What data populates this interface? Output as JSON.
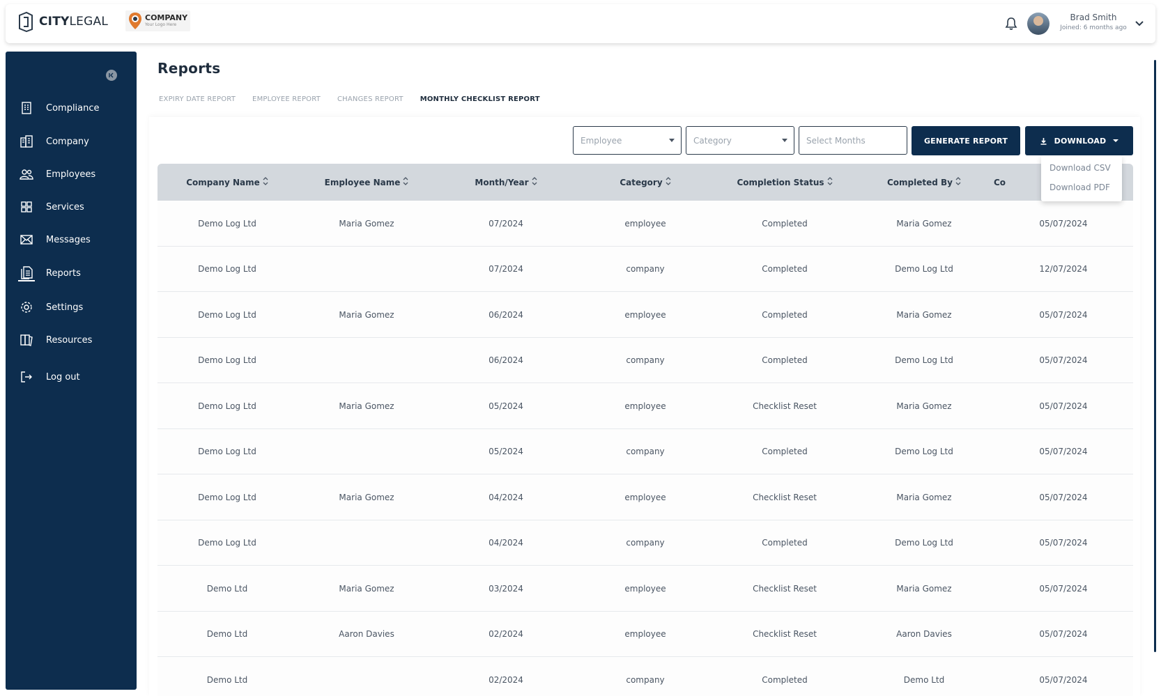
{
  "brand": {
    "name_bold": "CITY",
    "name_light": "LEGAL"
  },
  "company_logo": {
    "name": "COMPANY",
    "tagline": "Your Logo Here"
  },
  "user": {
    "name": "Brad Smith",
    "subtitle": "Joined: 6 months ago"
  },
  "sidebar": {
    "items": [
      {
        "label": "Compliance",
        "icon": "building-icon"
      },
      {
        "label": "Company",
        "icon": "office-icon"
      },
      {
        "label": "Employees",
        "icon": "users-icon"
      },
      {
        "label": "Services",
        "icon": "grid-icon"
      },
      {
        "label": "Messages",
        "icon": "envelope-icon"
      },
      {
        "label": "Reports",
        "icon": "document-icon",
        "active": true
      },
      {
        "label": "Settings",
        "icon": "gear-icon"
      },
      {
        "label": "Resources",
        "icon": "books-icon"
      },
      {
        "label": "Log out",
        "icon": "logout-icon"
      }
    ]
  },
  "page": {
    "title": "Reports"
  },
  "tabs": [
    {
      "label": "EXPIRY DATE REPORT"
    },
    {
      "label": "EMPLOYEE REPORT"
    },
    {
      "label": "CHANGES REPORT"
    },
    {
      "label": "MONTHLY CHECKLIST REPORT",
      "active": true
    }
  ],
  "filters": {
    "employee_placeholder": "Employee",
    "category_placeholder": "Category",
    "months_placeholder": "Select Months",
    "generate_label": "GENERATE REPORT",
    "download_label": "DOWNLOAD",
    "download_options": [
      "Download CSV",
      "Download PDF"
    ]
  },
  "table": {
    "columns": [
      "Company Name",
      "Employee Name",
      "Month/Year",
      "Category",
      "Completion Status",
      "Completed By",
      "Co"
    ],
    "rows": [
      [
        "Demo Log Ltd",
        "Maria Gomez",
        "07/2024",
        "employee",
        "Completed",
        "Maria Gomez",
        "05/07/2024"
      ],
      [
        "Demo Log Ltd",
        "",
        "07/2024",
        "company",
        "Completed",
        "Demo Log Ltd",
        "12/07/2024"
      ],
      [
        "Demo Log Ltd",
        "Maria Gomez",
        "06/2024",
        "employee",
        "Completed",
        "Maria Gomez",
        "05/07/2024"
      ],
      [
        "Demo Log Ltd",
        "",
        "06/2024",
        "company",
        "Completed",
        "Demo Log Ltd",
        "05/07/2024"
      ],
      [
        "Demo Log Ltd",
        "Maria Gomez",
        "05/2024",
        "employee",
        "Checklist Reset",
        "Maria Gomez",
        "05/07/2024"
      ],
      [
        "Demo Log Ltd",
        "",
        "05/2024",
        "company",
        "Completed",
        "Demo Log Ltd",
        "05/07/2024"
      ],
      [
        "Demo Log Ltd",
        "Maria Gomez",
        "04/2024",
        "employee",
        "Checklist Reset",
        "Maria Gomez",
        "05/07/2024"
      ],
      [
        "Demo Log Ltd",
        "",
        "04/2024",
        "company",
        "Completed",
        "Demo Log Ltd",
        "05/07/2024"
      ],
      [
        "Demo Ltd",
        "Maria Gomez",
        "03/2024",
        "employee",
        "Checklist Reset",
        "Maria Gomez",
        "05/07/2024"
      ],
      [
        "Demo Ltd",
        "Aaron Davies",
        "02/2024",
        "employee",
        "Checklist Reset",
        "Aaron Davies",
        "05/07/2024"
      ],
      [
        "Demo Ltd",
        "",
        "02/2024",
        "company",
        "Completed",
        "Demo Ltd",
        "05/07/2024"
      ]
    ]
  },
  "colors": {
    "sidebar": "#0d2d4e",
    "accent": "#0d2d4e",
    "table_header": "#d3d8dd"
  }
}
